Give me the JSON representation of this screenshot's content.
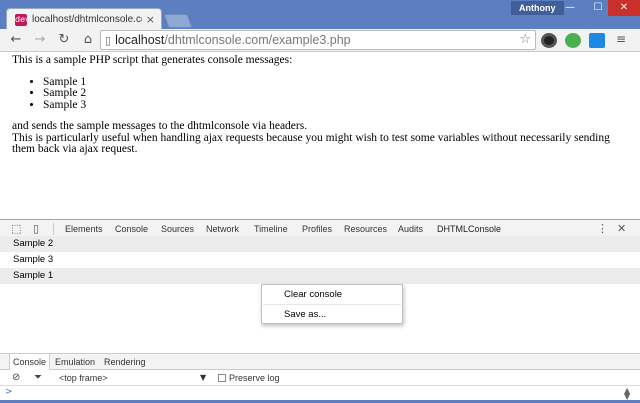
{
  "browser": {
    "tab_title": "localhost/dhtmlconsole.co",
    "tab_favicon": "dev",
    "user": "Anthony",
    "url_host": "localhost",
    "url_path": "/dhtmlconsole.com/example3.php",
    "window_buttons": {
      "minimize": "—",
      "maximize": "☐",
      "close": "✕"
    }
  },
  "page": {
    "intro": "This is a sample PHP script that generates console messages:",
    "list": [
      "Sample 1",
      "Sample 2",
      "Sample 3"
    ],
    "line1": "and sends the sample messages to the dhtmlconsole via headers.",
    "line2": "This is particularly useful when handling ajax requests because you might wish to test some variables without necessarily sending them back via ajax request."
  },
  "devtools": {
    "tabs": [
      "Elements",
      "Console",
      "Sources",
      "Network",
      "Timeline",
      "Profiles",
      "Resources",
      "Audits",
      "DHTMLConsole"
    ],
    "active_tab": "DHTMLConsole",
    "log_rows": [
      "Sample 2",
      "Sample 3",
      "Sample 1"
    ],
    "context_menu": [
      "Clear console",
      "Save as..."
    ],
    "drawer_tabs": [
      "Console",
      "Emulation",
      "Rendering"
    ],
    "frame_select": "<top frame>",
    "preserve_log_label": "Preserve log",
    "prompt": ">"
  }
}
